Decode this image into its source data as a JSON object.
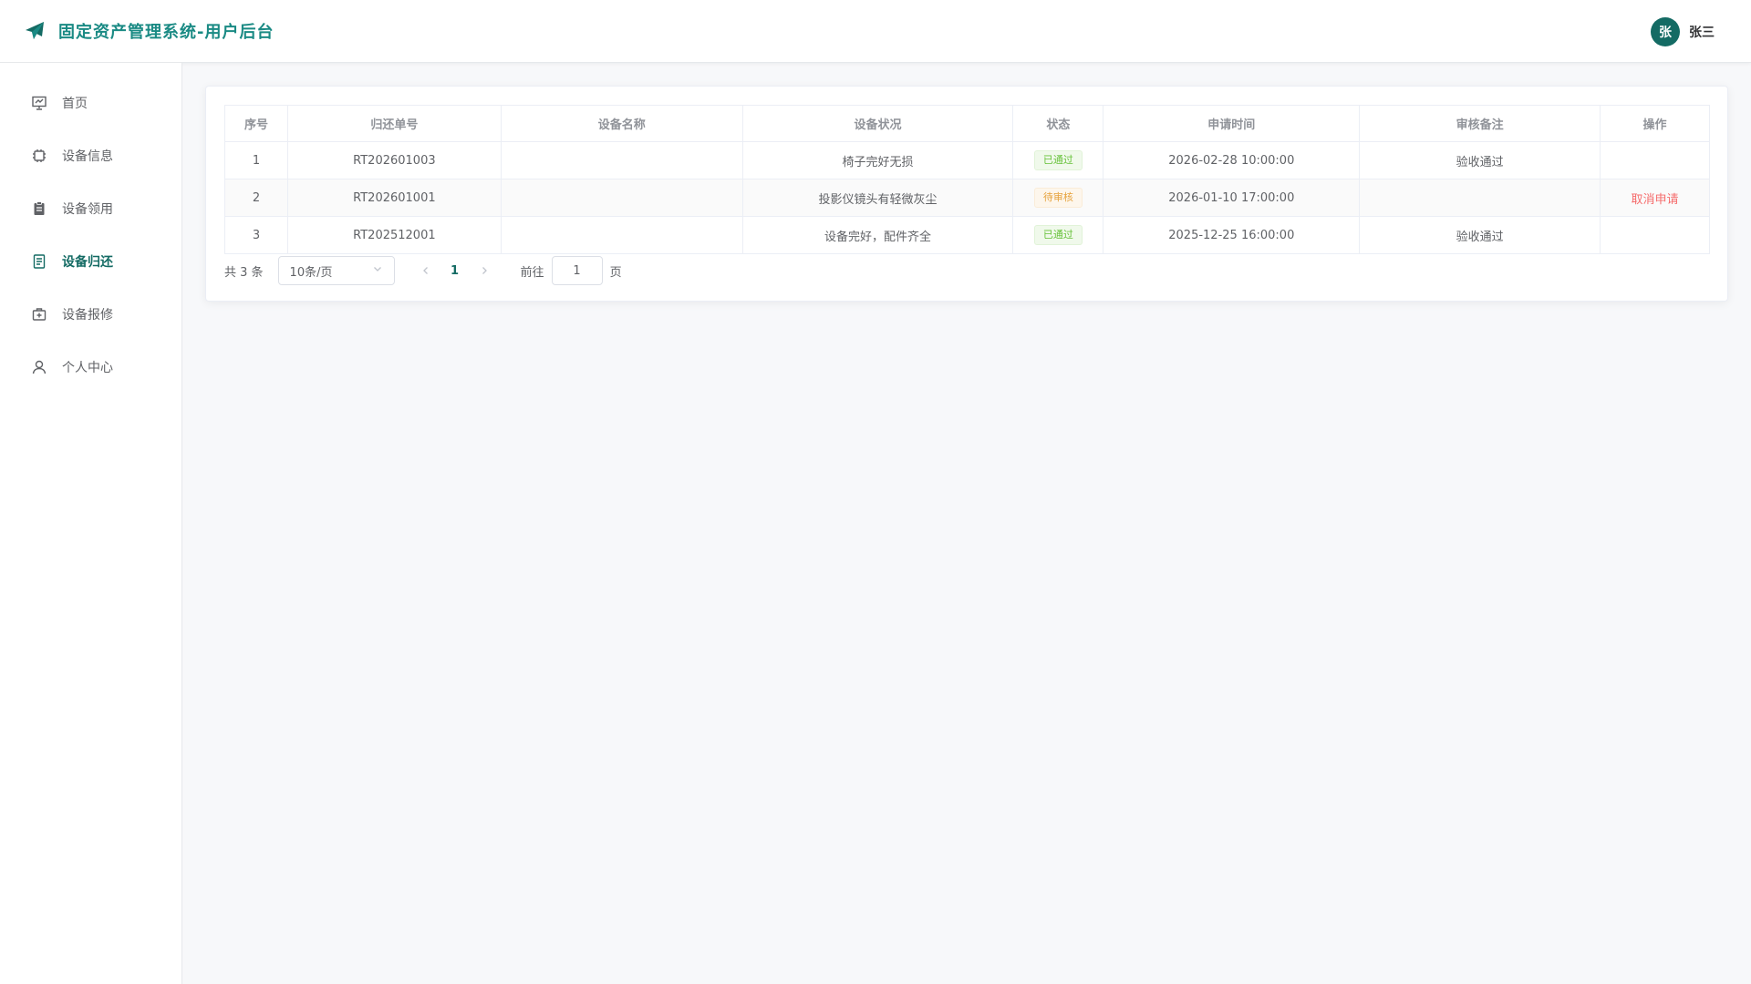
{
  "app": {
    "title": "固定资产管理系统-用户后台"
  },
  "user": {
    "avatar_text": "张",
    "name": "张三"
  },
  "sidebar": {
    "items": [
      {
        "label": "首页",
        "icon": "dashboard-icon",
        "active": false
      },
      {
        "label": "设备信息",
        "icon": "chip-icon",
        "active": false
      },
      {
        "label": "设备领用",
        "icon": "clipboard-icon",
        "active": false
      },
      {
        "label": "设备归还",
        "icon": "document-icon",
        "active": true
      },
      {
        "label": "设备报修",
        "icon": "repair-kit-icon",
        "active": false
      },
      {
        "label": "个人中心",
        "icon": "user-icon",
        "active": false
      }
    ]
  },
  "table": {
    "headers": [
      "序号",
      "归还单号",
      "设备名称",
      "设备状况",
      "状态",
      "申请时间",
      "审核备注",
      "操作"
    ],
    "rows": [
      {
        "index": "1",
        "return_no": "RT202601003",
        "device_name": "",
        "condition": "椅子完好无损",
        "status": "已通过",
        "status_type": "success",
        "apply_time": "2026-02-28 10:00:00",
        "remark": "验收通过",
        "action": ""
      },
      {
        "index": "2",
        "return_no": "RT202601001",
        "device_name": "",
        "condition": "投影仪镜头有轻微灰尘",
        "status": "待审核",
        "status_type": "warning",
        "apply_time": "2026-01-10 17:00:00",
        "remark": "",
        "action": "取消申请"
      },
      {
        "index": "3",
        "return_no": "RT202512001",
        "device_name": "",
        "condition": "设备完好，配件齐全",
        "status": "已通过",
        "status_type": "success",
        "apply_time": "2025-12-25 16:00:00",
        "remark": "验收通过",
        "action": ""
      }
    ]
  },
  "pagination": {
    "total_text": "共 3 条",
    "page_size": "10条/页",
    "current_page": "1",
    "goto_label": "前往",
    "goto_value": "1",
    "page_suffix": "页"
  },
  "colors": {
    "brand": "#1a8a84",
    "accent": "#146b64",
    "success": "#67c23a",
    "warning": "#e6a23c",
    "danger": "#f56c6c"
  }
}
